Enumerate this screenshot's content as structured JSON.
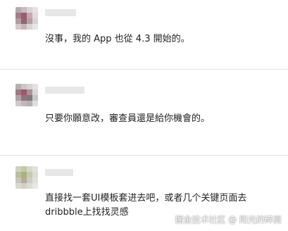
{
  "comments": [
    {
      "name_blurred": true,
      "avatar": "blurred-avatar",
      "text_lines": [
        "沒事，我的 App 也從 4.3 開始的。"
      ]
    },
    {
      "name_blurred": true,
      "avatar": "blurred-avatar",
      "text_lines": [
        "只要你願意改，審查員還是給你機會的。"
      ]
    },
    {
      "name_blurred": true,
      "avatar": "blurred-avatar",
      "text_lines": [
        "直接找一套UI模板套进去吧，或者几个关键页面去",
        "dribbble上找找灵感"
      ]
    }
  ],
  "watermark": "掘金技术社区 @ 阳光的碎屑",
  "colors": {
    "background": "#ffffff",
    "text": "#222222",
    "divider": "#e6e6e6"
  }
}
